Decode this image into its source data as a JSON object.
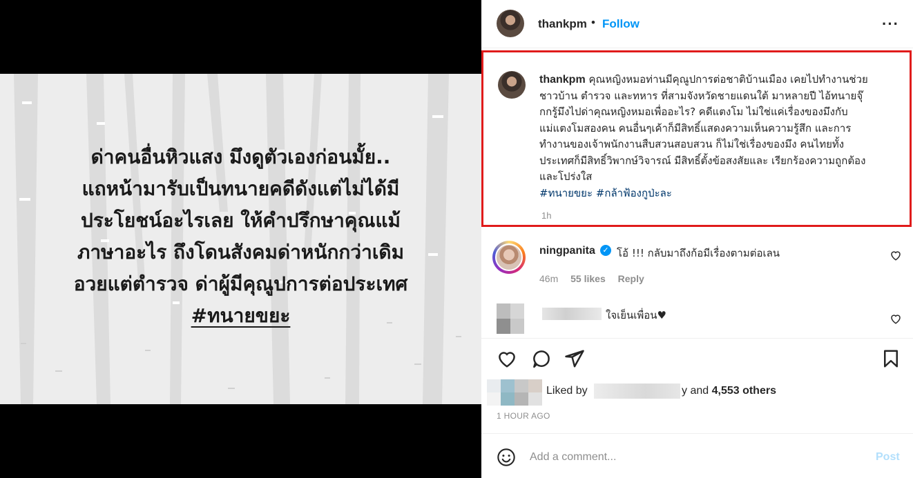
{
  "post": {
    "quote_lines": [
      "ด่าคนอื่นหิวแสง มึงดูตัวเองก่อนมั้ย..",
      "แถหน้ามารับเป็นทนายคดีดังแต่ไม่ได้มี",
      "ประโยชน์อะไรเลย ให้คำปรึกษาคุณแม้",
      "ภาษาอะไร ถึงโดนสังคมด่าหนักกว่าเดิม",
      "อวยแต่ตำรวจ ด่าผู้มีคุณูปการต่อประเทศ"
    ],
    "quote_hashtag": "#ทนายขยะ"
  },
  "header": {
    "username": "thankpm",
    "separator": "•",
    "follow_label": "Follow",
    "more_label": "···"
  },
  "caption": {
    "username": "thankpm",
    "lines": [
      "คุณหญิงหมอท่านมีคุณูปการต่อชาติบ้านเมือง เคยไปทำงานช่วย",
      "ชาวบ้าน ตำรวจ และทหาร ที่สามจังหวัดชายแดนใต้ มาหลายปี ไอ้ทนายจุ๊",
      "กกรู้มึงไปด่าคุณหญิงหมอเพื่ออะไร? คดีแตงโม ไม่ใช่แค่เรื่องของมึงกับ",
      "แม่แตงโมสองคน คนอื่นๆเค้าก็มีสิทธิ์แสดงความเห็นความรู้สึก และการ",
      "ทำงานของเจ้าพนักงานสืบสวนสอบสวน ก็ไม่ใช่เรื่องของมึง คนไทยทั้ง",
      "ประเทศก็มีสิทธิ์วิพากษ์วิจารณ์ มีสิทธิ์ตั้งข้อสงสัยและ เรียกร้องความถูกต้อง",
      "และโปร่งใส"
    ],
    "hashtags": "#ทนายขยะ #กล้าฟ้องกูป่ะละ",
    "time": "1h"
  },
  "comments": [
    {
      "username": "ningpanita",
      "verified_mark": "✓",
      "text": "โอ้ !!! กลับมาถึงก้อมีเรื่องตามต่อเลน",
      "time": "46m",
      "likes": "55 likes",
      "reply_label": "Reply"
    },
    {
      "text": "ใจเย็นเพื่อน♥"
    }
  ],
  "likes": {
    "prefix": "Liked by",
    "suffix_connector": "y and",
    "count_label": "4,553 others"
  },
  "timestamp": "1 HOUR AGO",
  "comment_bar": {
    "placeholder": "Add a comment...",
    "post_label": "Post"
  },
  "colors": {
    "accent": "#0095f6",
    "highlight_border": "#e01b1b",
    "hashtag": "#00376b",
    "muted": "#8e8e8e"
  }
}
